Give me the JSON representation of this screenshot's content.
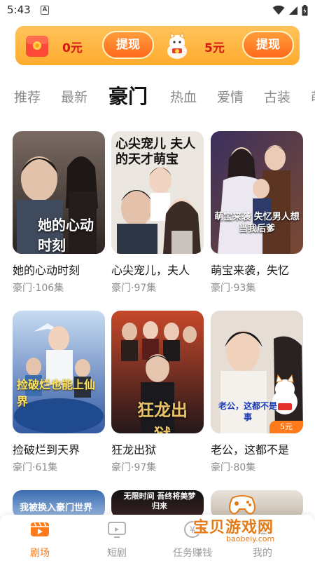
{
  "status_bar": {
    "time": "5:43",
    "notification_letter": "A"
  },
  "reward_banner": {
    "left_amount": "0元",
    "left_button": "提现",
    "right_amount": "5元",
    "right_button": "提现",
    "accent_color": "#ffab2e",
    "amount_color": "#d11a14"
  },
  "tabs": [
    {
      "label": "推荐",
      "active": false
    },
    {
      "label": "最新",
      "active": false
    },
    {
      "label": "豪门",
      "active": true
    },
    {
      "label": "热血",
      "active": false
    },
    {
      "label": "爱情",
      "active": false
    },
    {
      "label": "古装",
      "active": false
    },
    {
      "label": "萌",
      "active": false
    }
  ],
  "dramas": [
    {
      "title": "她的心动时刻",
      "meta": "豪门·106集",
      "poster_text": "她的心动时刻",
      "poster_colors": [
        "#6e5f58",
        "#2b2320"
      ]
    },
    {
      "title": "心尖宠儿，夫人",
      "meta": "豪门·97集",
      "poster_text": "心尖宠儿 夫人的天才萌宝",
      "poster_colors": [
        "#e9e4df",
        "#3a3a42"
      ]
    },
    {
      "title": "萌宝来袭，失忆",
      "meta": "豪门·93集",
      "poster_text": "萌宝来袭 失忆男人想当我后爹",
      "poster_colors": [
        "#3a2e5c",
        "#6a3f2e"
      ]
    },
    {
      "title": "捡破烂到天界",
      "meta": "豪门·61集",
      "poster_text": "捡破烂也能上仙界",
      "poster_colors": [
        "#a9c4e8",
        "#3a5fa8"
      ]
    },
    {
      "title": "狂龙出狱",
      "meta": "豪门·97集",
      "poster_text": "狂龙出狱",
      "poster_colors": [
        "#b33a22",
        "#2a1c18"
      ]
    },
    {
      "title": "老公，这都不是",
      "meta": "豪门·80集",
      "poster_text": "老公，这都不是事",
      "poster_colors": [
        "#e8e1d8",
        "#b9a89a"
      ],
      "badge": "5元"
    }
  ],
  "partial_row_texts": [
    "我被换入豪门世界",
    "无限时间 吾终将美梦归来",
    ""
  ],
  "bottom_nav": [
    {
      "label": "剧场",
      "icon": "theater-icon",
      "active": true
    },
    {
      "label": "短剧",
      "icon": "tv-icon",
      "active": false
    },
    {
      "label": "任务赚钱",
      "icon": "task-icon",
      "active": false
    },
    {
      "label": "我的",
      "icon": "profile-icon",
      "active": false
    }
  ],
  "watermark": {
    "text": "宝贝游戏网",
    "url": "baobeiy.com"
  }
}
